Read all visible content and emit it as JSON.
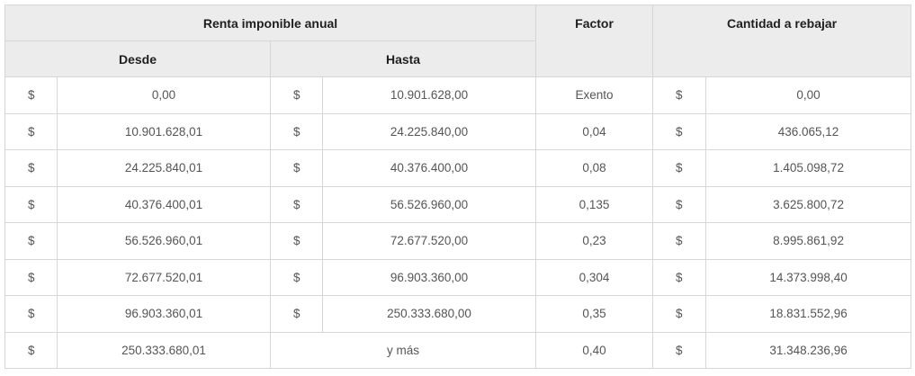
{
  "headers": {
    "renta": "Renta imponible anual",
    "desde": "Desde",
    "hasta": "Hasta",
    "factor": "Factor",
    "cantidad": "Cantidad a rebajar"
  },
  "rows": [
    {
      "c1": "$",
      "desde": "0,00",
      "c2": "$",
      "hasta": "10.901.628,00",
      "factor": "Exento",
      "c3": "$",
      "cantidad": "0,00"
    },
    {
      "c1": "$",
      "desde": "10.901.628,01",
      "c2": "$",
      "hasta": "24.225.840,00",
      "factor": "0,04",
      "c3": "$",
      "cantidad": "436.065,12"
    },
    {
      "c1": "$",
      "desde": "24.225.840,01",
      "c2": "$",
      "hasta": "40.376.400,00",
      "factor": "0,08",
      "c3": "$",
      "cantidad": "1.405.098,72"
    },
    {
      "c1": "$",
      "desde": "40.376.400,01",
      "c2": "$",
      "hasta": "56.526.960,00",
      "factor": "0,135",
      "c3": "$",
      "cantidad": "3.625.800,72"
    },
    {
      "c1": "$",
      "desde": "56.526.960,01",
      "c2": "$",
      "hasta": "72.677.520,00",
      "factor": "0,23",
      "c3": "$",
      "cantidad": "8.995.861,92"
    },
    {
      "c1": "$",
      "desde": "72.677.520,01",
      "c2": "$",
      "hasta": "96.903.360,00",
      "factor": "0,304",
      "c3": "$",
      "cantidad": "14.373.998,40"
    },
    {
      "c1": "$",
      "desde": "96.903.360,01",
      "c2": "$",
      "hasta": "250.333.680,00",
      "factor": "0,35",
      "c3": "$",
      "cantidad": "18.831.552,96"
    }
  ],
  "last_row": {
    "c1": "$",
    "desde": "250.333.680,01",
    "hasta_text": "y más",
    "factor": "0,40",
    "c3": "$",
    "cantidad": "31.348.236,96"
  },
  "colors": {
    "header_bg": "#ececec",
    "border": "#d6d6d6",
    "text": "#555555"
  }
}
